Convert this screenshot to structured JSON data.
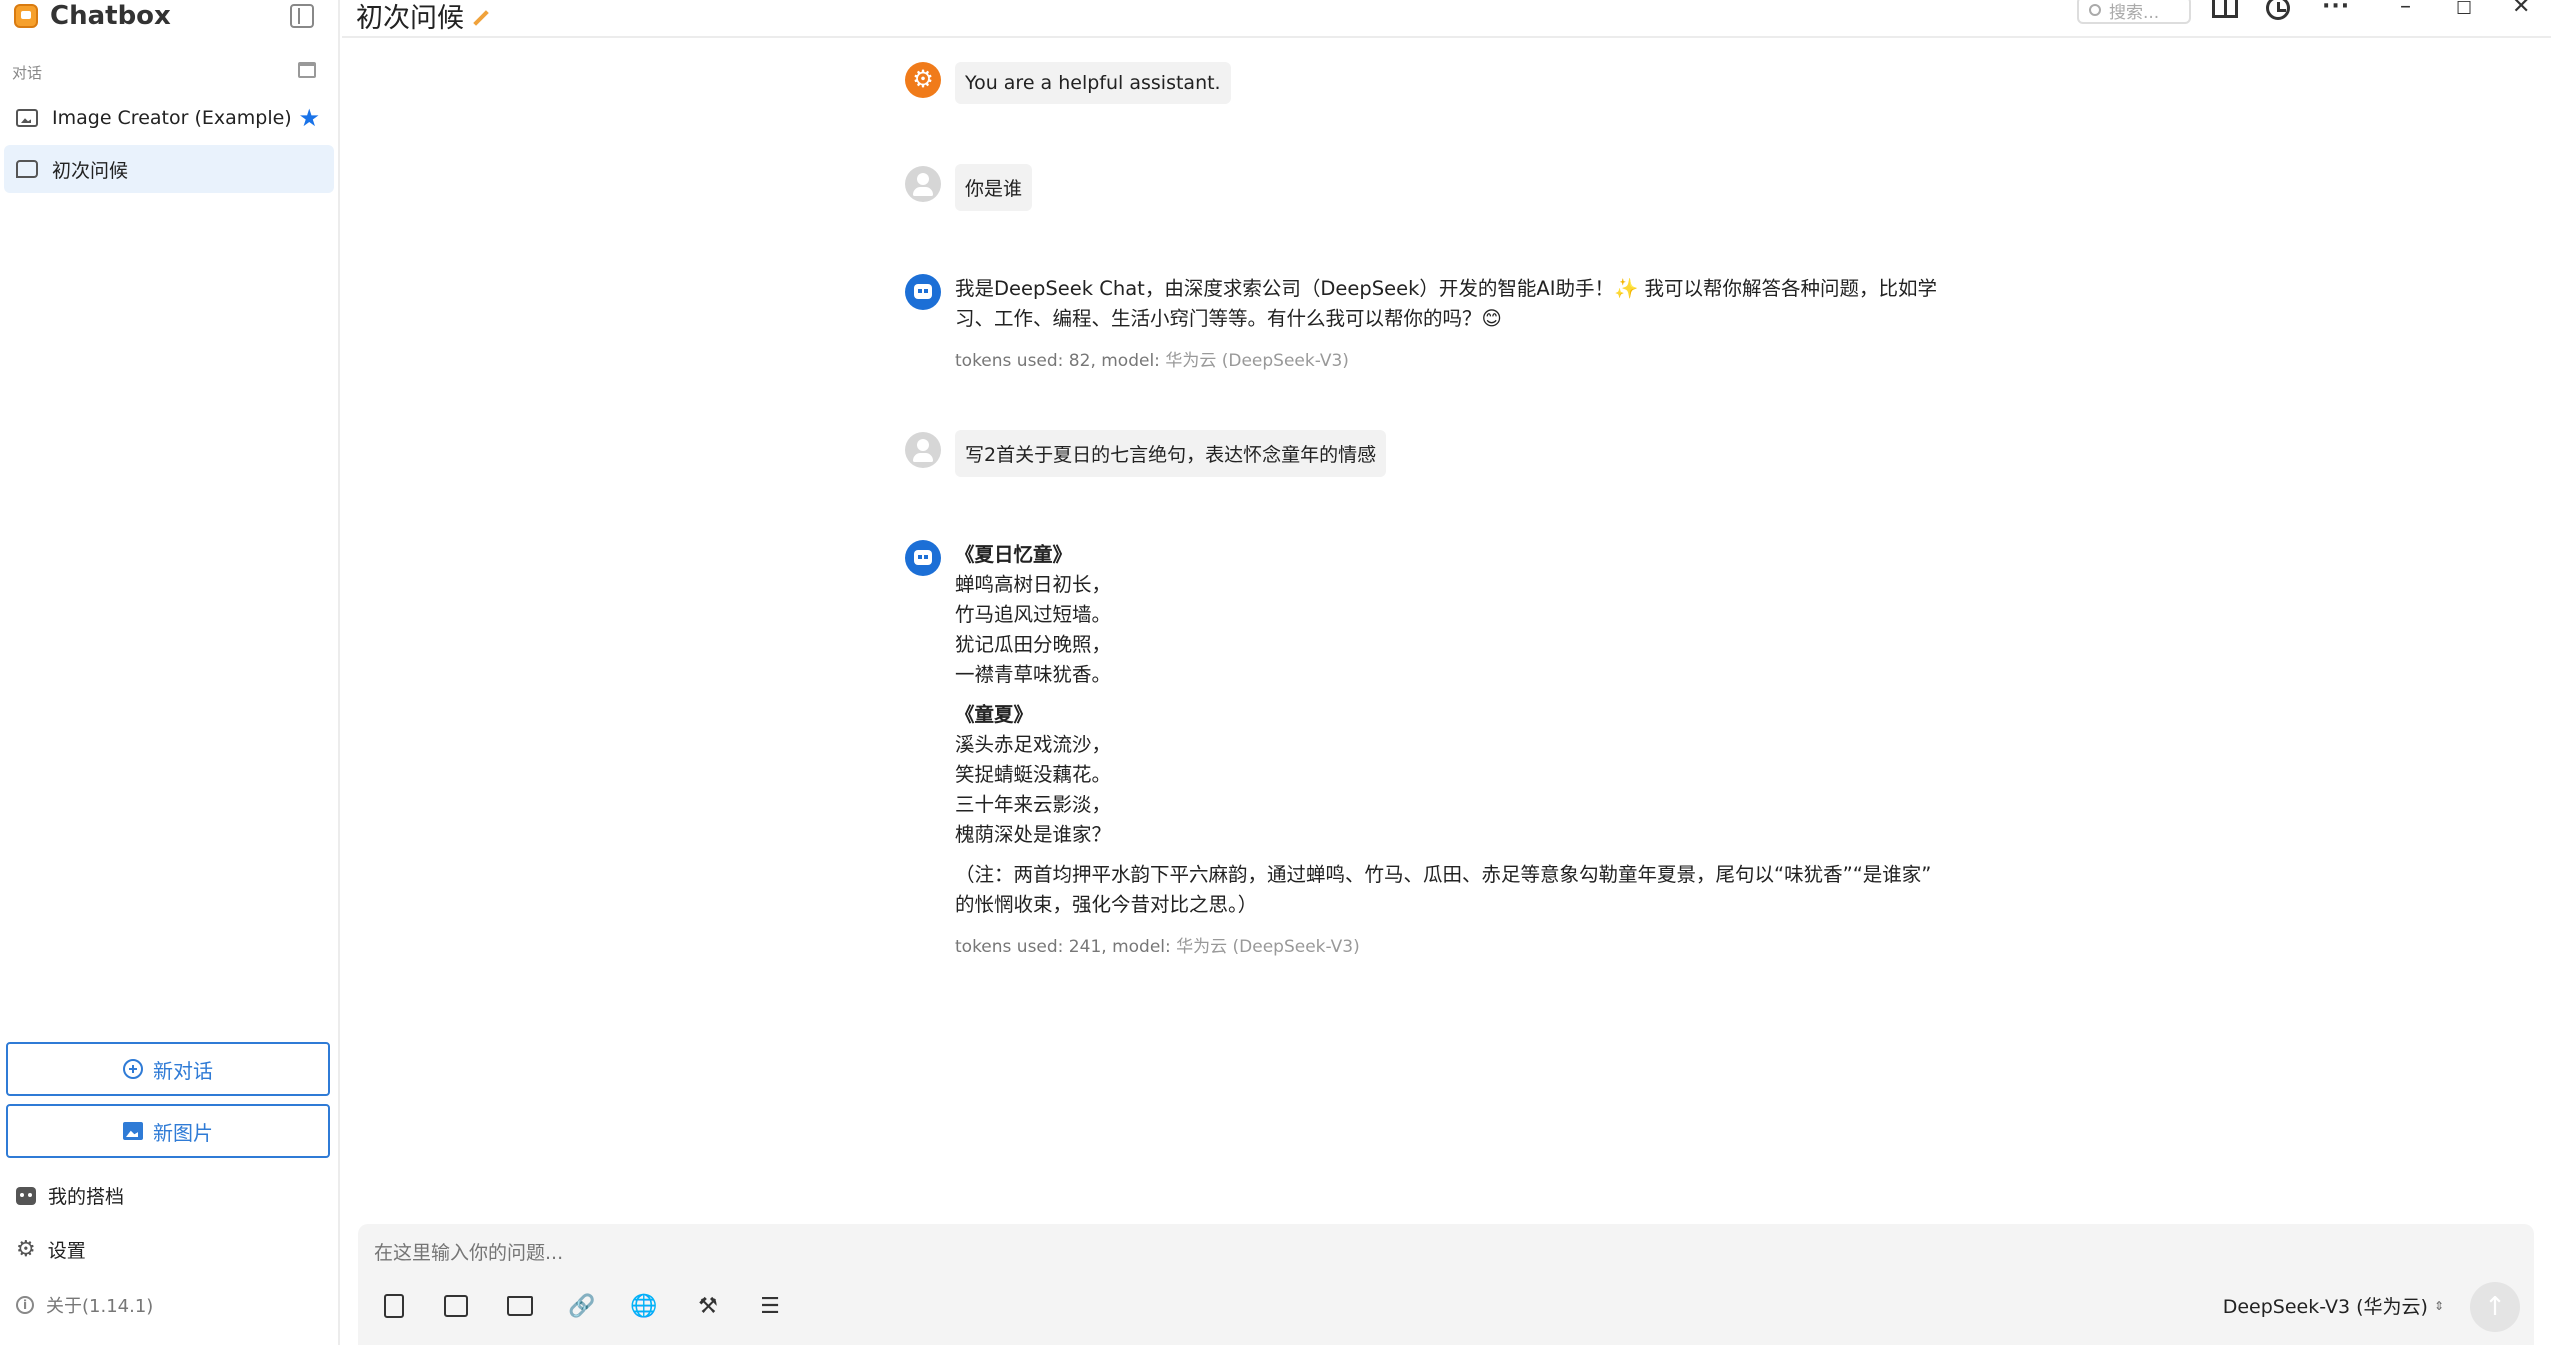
{
  "sidebar": {
    "app_name": "Chatbox",
    "section_label": "对话",
    "conversations": [
      {
        "label": "Image Creator (Example)",
        "starred": true
      },
      {
        "label": "初次问候",
        "active": true
      }
    ],
    "new_chat_label": "新对话",
    "new_image_label": "新图片",
    "my_partners_label": "我的搭档",
    "settings_label": "设置",
    "about_label": "关于(1.14.1)"
  },
  "header": {
    "title": "初次问候",
    "search_placeholder": "搜索..."
  },
  "messages": {
    "system": "You are a helpful assistant.",
    "user1": "你是谁",
    "assistant1": {
      "line1": "我是DeepSeek Chat，由深度求索公司（DeepSeek）开发的智能AI助手！✨ 我可以帮你解答各种问题，比如学",
      "line2": "习、工作、编程、生活小窍门等等。有什么我可以帮你的吗？😊",
      "meta_prefix": "tokens used: 82, model: ",
      "meta_model": "华为云 (DeepSeek-V3)"
    },
    "user2": "写2首关于夏日的七言绝句，表达怀念童年的情感",
    "assistant2": {
      "poem1_title": "《夏日忆童》",
      "poem1_lines": [
        "蝉鸣高树日初长，",
        "竹马追风过短墙。",
        "犹记瓜田分晚照，",
        "一襟青草味犹香。"
      ],
      "poem2_title": "《童夏》",
      "poem2_lines": [
        "溪头赤足戏流沙，",
        "笑捉蜻蜓没藕花。",
        "三十年来云影淡，",
        "槐荫深处是谁家？"
      ],
      "note_line1": "（注：两首均押平水韵下平六麻韵，通过蝉鸣、竹马、瓜田、赤足等意象勾勒童年夏景，尾句以“味犹香”“是谁家”",
      "note_line2": "的怅惘收束，强化今昔对比之思。）",
      "meta_prefix": "tokens used: 241, model: ",
      "meta_model": "华为云 (DeepSeek-V3)"
    }
  },
  "composer": {
    "placeholder": "在这里输入你的问题...",
    "model_label": "DeepSeek-V3 (华为云)"
  },
  "colors": {
    "accent": "#2f7bd6",
    "system_avatar": "#f07b1a",
    "bot_avatar": "#1c6fd6",
    "active_item_bg": "#e9f2fc"
  }
}
